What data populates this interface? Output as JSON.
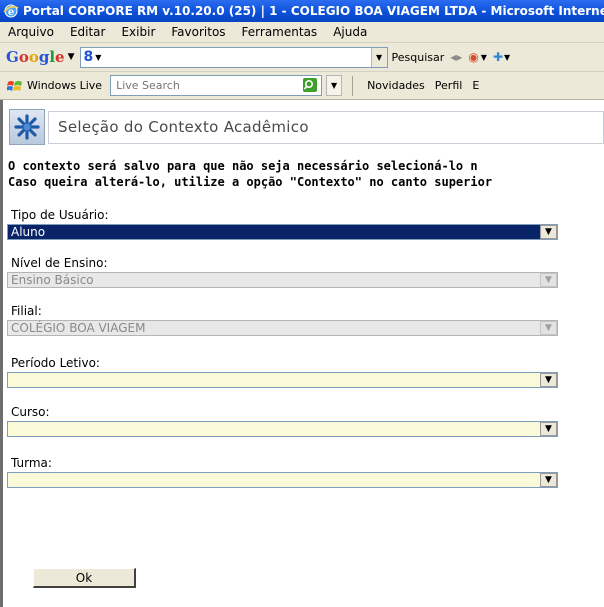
{
  "window": {
    "title": "Portal CORPORE RM v.10.20.0 (25) | 1 - COLEGIO BOA VIAGEM LTDA - Microsoft Internet Explorer"
  },
  "menu": {
    "items": [
      "Arquivo",
      "Editar",
      "Exibir",
      "Favoritos",
      "Ferramentas",
      "Ajuda"
    ]
  },
  "google_toolbar": {
    "logo": [
      "G",
      "o",
      "o",
      "g",
      "l",
      "e"
    ],
    "search_prefix": "8",
    "search_button": "Pesquisar"
  },
  "live_toolbar": {
    "label": "Windows Live",
    "search_placeholder": "Live Search",
    "links": [
      "Novidades",
      "Perfil",
      "E"
    ]
  },
  "page": {
    "title": "Seleção do Contexto Acadêmico",
    "intro_line1": "O contexto será salvo para que não seja necessário selecioná-lo n",
    "intro_line2": "Caso queira alterá-lo, utilize a opção \"Contexto\" no canto superior",
    "fields": {
      "tipo_usuario": {
        "label": "Tipo de Usuário:",
        "value": "Aluno"
      },
      "nivel_ensino": {
        "label": "Nível de Ensino:",
        "value": "Ensino Básico"
      },
      "filial": {
        "label": "Filial:",
        "value": "COLÉGIO BOA VIAGEM"
      },
      "periodo_letivo": {
        "label": "Período Letivo:",
        "value": ""
      },
      "curso": {
        "label": "Curso:",
        "value": ""
      },
      "turma": {
        "label": "Turma:",
        "value": ""
      }
    },
    "ok_button": "Ok"
  },
  "colors": {
    "titlebar": "#0a4fd8",
    "selected_option": "#0a246a",
    "empty_select_bg": "#fafad8",
    "disabled_select_bg": "#e8e8e8"
  }
}
